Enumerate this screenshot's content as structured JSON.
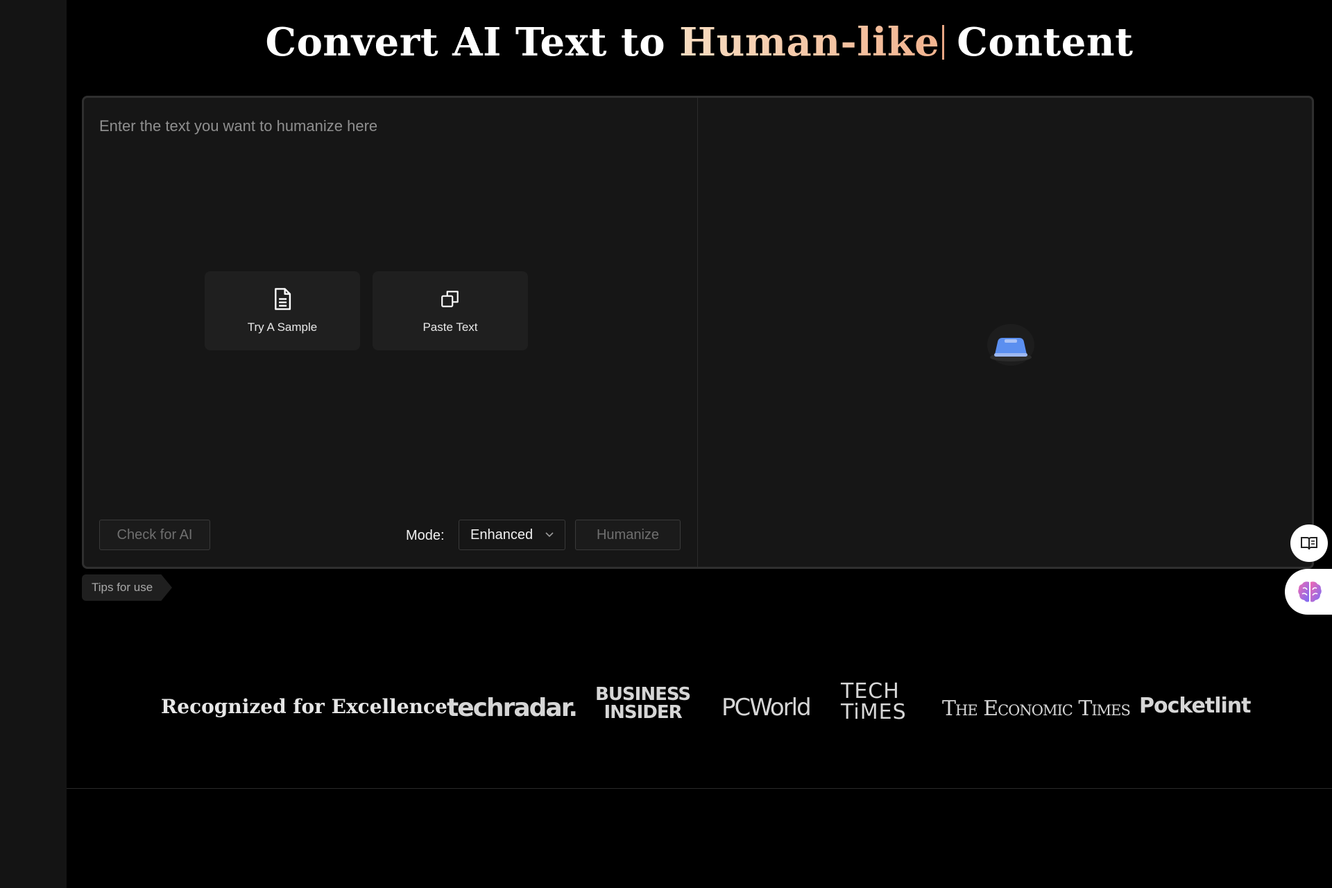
{
  "title": {
    "part1": "Convert AI Text to ",
    "accent": "Human-like",
    "part2": "Content"
  },
  "editor": {
    "placeholder": "Enter the text you want to humanize here",
    "actions": {
      "sample_label": "Try A Sample",
      "paste_label": "Paste Text"
    },
    "bottom": {
      "check_label": "Check for AI",
      "mode_label": "Mode:",
      "mode_value": "Enhanced",
      "humanize_label": "Humanize"
    }
  },
  "tips_label": "Tips for use",
  "recognized": {
    "label": "Recognized for Excellence:",
    "logos": {
      "techradar": "techradar.",
      "bi_line1": "BUSINESS",
      "bi_line2": "INSIDER",
      "pcworld": "PCWorld",
      "tech_line1": "TECH",
      "tech_line2": "TiMES",
      "economic_times": "The Economic Times",
      "pocketlint": "Pocketlint"
    }
  },
  "icons": {
    "sample": "document-icon",
    "paste": "copy-icon",
    "mode": "chevron-down-icon",
    "loader": "loader-icon",
    "reader": "book-icon",
    "assistant": "brain-icon"
  },
  "colors": {
    "accent_start": "#f7dcc0",
    "accent_end": "#f2b38f",
    "loader_blue": "#5b8ff0"
  }
}
